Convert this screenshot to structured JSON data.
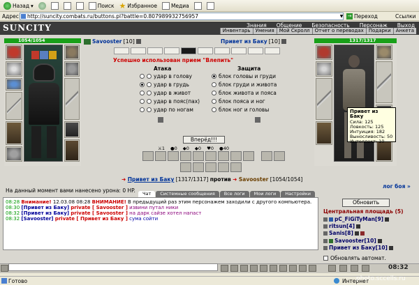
{
  "browser": {
    "back_label": "Назад",
    "search_label": "Поиск",
    "favorites_label": "Избранное",
    "media_label": "Медиа",
    "address_label": "Адрес",
    "url": "http://suncity.combats.ru/buttons.pl?battle=0.807989932756957",
    "go_label": "Переход",
    "links_label": "Ссылки"
  },
  "game": {
    "logo": "SUNCITY",
    "nav_main": [
      "Знания",
      "Общение",
      "Безопасность",
      "Персонаж",
      "Выход"
    ],
    "nav_sub": [
      "Инвентарь",
      "Умения",
      "Мой Скролл",
      "Отчет о переводах",
      "Подарки",
      "Анкета"
    ]
  },
  "fighters": {
    "left": {
      "name": "Savooster",
      "level": "[10]",
      "hp_text": "1054/1054"
    },
    "right": {
      "name": "Привет из Баку",
      "level": "[10]",
      "hp_text": "1317/1317"
    }
  },
  "combat": {
    "success_msg": "Успешно использован прием \"Влепить\"",
    "attack_title": "Атака",
    "defense_title": "Защита",
    "attack_options": [
      {
        "label": "удар в голову",
        "checked": false
      },
      {
        "label": "удар в грудь",
        "checked": true
      },
      {
        "label": "удар в живот",
        "checked": false
      },
      {
        "label": "удар в пояс(пах)",
        "checked": false
      },
      {
        "label": "удар по ногам",
        "checked": false
      }
    ],
    "defense_options": [
      {
        "label": "блок головы и груди",
        "checked": true
      },
      {
        "label": "блок груди и живота",
        "checked": false
      },
      {
        "label": "блок живота и пояса",
        "checked": false
      },
      {
        "label": "блок пояса и ног",
        "checked": false
      },
      {
        "label": "блок ног и головы",
        "checked": false
      }
    ],
    "forward_label": "Вперёд!!!",
    "stats": [
      "1",
      "0",
      "0",
      "0",
      "0",
      "40"
    ],
    "fight_left_name": "Привет из Баку",
    "fight_left_hp": "[1317/1317]",
    "vs_label": "против",
    "fight_right_name": "Savooster",
    "fight_right_hp": "[1054/1054]",
    "damage_text": "На данный момент вами нанесено урона: 0 HP.",
    "log_link": "лог боя »"
  },
  "tooltip": {
    "title": "Привет из Баку",
    "lines": [
      "Сила: 125",
      "Ловкость: 125",
      "Интуиция: 182",
      "Выносливость: 50",
      "Интеллект: 10"
    ]
  },
  "chat": {
    "tabs": [
      "Чат",
      "Системные сообщения",
      "Все логи",
      "Мои логи",
      "Настройки"
    ],
    "messages": [
      {
        "time": "08:28",
        "a": "Внимание!",
        "b": "12.03.08 08:28",
        "c": "ВНИМАНИЕ!",
        "d": "В предыдущий раз этим персонажем заходили с другого компьютера."
      },
      {
        "time": "08:30",
        "from": "[Привет из Баку]",
        "priv": "private [ Savooster ]",
        "text": "извини путал ники"
      },
      {
        "time": "08:32",
        "from": "[Привет из Баку]",
        "priv": "private [ Savooster ]",
        "text": "на дарк сайзе хотел напаст"
      },
      {
        "time": "08:32",
        "from": "[Savooster]",
        "priv": "private [ Привет из Баку ]",
        "text": "сума сойти"
      }
    ]
  },
  "room": {
    "refresh_label": "Обновить",
    "title": "Центральная площадь (5)",
    "users": [
      "pC_FiGiTyMan[9]",
      "ritsun[4]",
      "Sanis[8]",
      "Savooster[10]",
      "Привет из Баку[10]"
    ],
    "auto_refresh_label": "Обновлять автомат."
  },
  "bottom": {
    "clock": "08:32"
  },
  "status": {
    "ready": "Готово",
    "zone": "Интернет"
  },
  "watermark": "photo.sccells.ru"
}
